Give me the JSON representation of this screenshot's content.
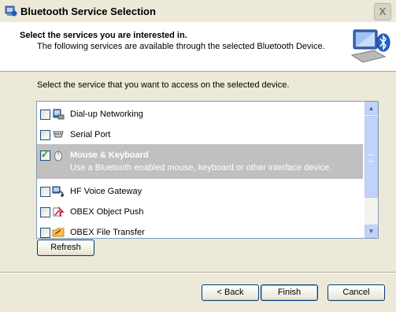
{
  "window": {
    "title": "Bluetooth Service Selection",
    "close_glyph": "X"
  },
  "header": {
    "title": "Select the services you are interested in.",
    "subtitle": "The following services are available through the selected Bluetooth Device.",
    "icon": "bluetooth-computer-icon"
  },
  "content": {
    "instruction": "Select the service that you want to access on the selected device.",
    "services": [
      {
        "label": "Dial-up Networking",
        "checked": false,
        "icon": "dialup-modem-icon"
      },
      {
        "label": "Serial Port",
        "checked": false,
        "icon": "serial-port-icon"
      },
      {
        "label": "Mouse & Keyboard",
        "checked": true,
        "selected": true,
        "icon": "mouse-icon",
        "description": "Use a Bluetooth enabled mouse, keyboard or other interface device."
      },
      {
        "label": "HF Voice Gateway",
        "checked": false,
        "icon": "voice-gateway-icon"
      },
      {
        "label": "OBEX Object Push",
        "checked": false,
        "icon": "object-push-icon"
      },
      {
        "label": "OBEX File Transfer",
        "checked": false,
        "icon": "file-transfer-icon"
      }
    ],
    "refresh_label": "Refresh"
  },
  "footer": {
    "back_label": "< Back",
    "finish_label": "Finish",
    "cancel_label": "Cancel"
  },
  "colors": {
    "selection": "#c0c0c0",
    "dialog_bg": "#ece9d8",
    "list_border": "#7f9db9",
    "scroll_blue": "#c1d3fb"
  }
}
